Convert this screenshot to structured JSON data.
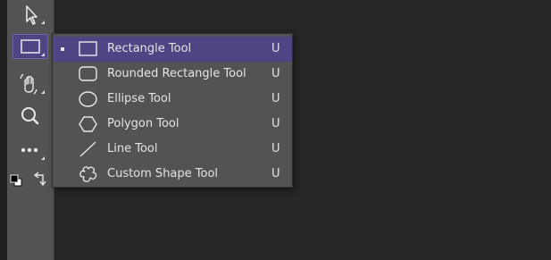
{
  "colors": {
    "toolbar_bg": "#535353",
    "canvas_bg": "#262626",
    "selection": "#4e4684",
    "text": "#e4e4e4"
  },
  "toolbar": {
    "tools": [
      {
        "name": "move-tool",
        "icon": "arrow-cursor-icon"
      },
      {
        "name": "rectangle-tool",
        "icon": "rectangle-icon",
        "active": true
      },
      {
        "name": "hand-rotate-tool",
        "icon": "hand-rotate-icon"
      },
      {
        "name": "zoom-tool",
        "icon": "magnifier-icon"
      },
      {
        "name": "more-tools",
        "icon": "ellipsis-icon"
      },
      {
        "name": "color-swatches",
        "icon": "color-swatch-icon"
      },
      {
        "name": "swap-colors",
        "icon": "swap-arrows-icon"
      }
    ]
  },
  "flyout": {
    "items": [
      {
        "label": "Rectangle Tool",
        "shortcut": "U",
        "icon": "rectangle-icon",
        "selected": true
      },
      {
        "label": "Rounded Rectangle Tool",
        "shortcut": "U",
        "icon": "rounded-rectangle-icon"
      },
      {
        "label": "Ellipse Tool",
        "shortcut": "U",
        "icon": "ellipse-icon"
      },
      {
        "label": "Polygon Tool",
        "shortcut": "U",
        "icon": "polygon-icon"
      },
      {
        "label": "Line Tool",
        "shortcut": "U",
        "icon": "line-icon"
      },
      {
        "label": "Custom Shape Tool",
        "shortcut": "U",
        "icon": "custom-shape-icon"
      }
    ]
  }
}
